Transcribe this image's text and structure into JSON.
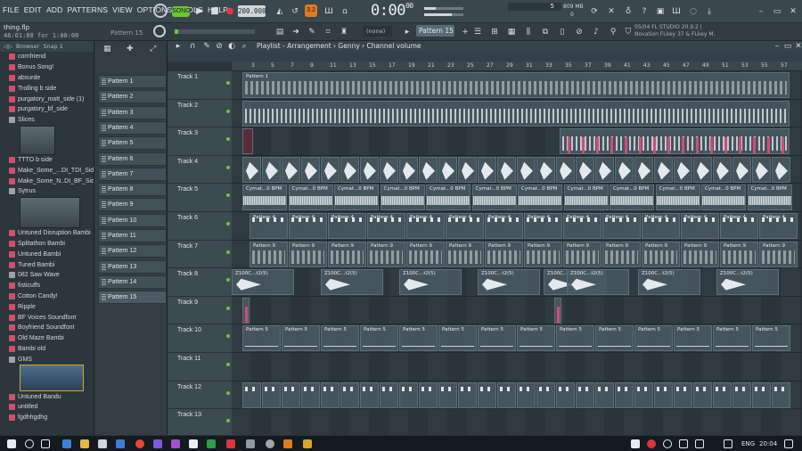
{
  "menu": [
    "FILE",
    "EDIT",
    "ADD",
    "PATTERNS",
    "VIEW",
    "OPTIONS",
    "TOOLS",
    "HELP"
  ],
  "toolbar": {
    "song_mode": "SONG",
    "bpm": "200.000",
    "time": "0:00",
    "time_sub": "00",
    "counter": "5",
    "memory": "809 MB",
    "memory_sub": "0",
    "step_label": "3.2"
  },
  "hint": {
    "title": "thing.flp",
    "time": "46:01:00 for 1:00:00",
    "pattern_label": "Pattern 15"
  },
  "pattern_select": "Pattern 15",
  "none_select": "(none)",
  "news": {
    "line1": "05/04  FL STUDIO 20.9.2 |",
    "line2": "Novation FLkey 37 & FLkey M."
  },
  "browser": {
    "header": [
      "Browser",
      "Snap 1"
    ],
    "items": [
      {
        "label": "cornfriend",
        "icon_color": "#d34d6f"
      },
      {
        "label": "Bonus Song!",
        "icon_color": "#d34d6f"
      },
      {
        "label": "absurde",
        "icon_color": "#d34d6f"
      },
      {
        "label": "Trolling b side",
        "icon_color": "#d34d6f"
      },
      {
        "label": "purgatory_matt_side (1)",
        "icon_color": "#d34d6f"
      },
      {
        "label": "purgatory_bf_side",
        "icon_color": "#d34d6f"
      },
      {
        "label": "Slices",
        "icon_color": "#9aa5ab"
      },
      {
        "label": "TTTO b side",
        "icon_color": "#d34d6f"
      },
      {
        "label": "Make_Some_...DI_TDI_Side",
        "icon_color": "#d34d6f"
      },
      {
        "label": "Make_Some_N..DI_BF_Side",
        "icon_color": "#d34d6f"
      },
      {
        "label": "Sytrus",
        "icon_color": "#9aa5ab"
      },
      {
        "label": "Untuned Disruption Bambi",
        "icon_color": "#d34d6f"
      },
      {
        "label": "Splitathon Bambi",
        "icon_color": "#d34d6f"
      },
      {
        "label": "Untuned Bambi",
        "icon_color": "#d34d6f"
      },
      {
        "label": "Tuned Bambi",
        "icon_color": "#d34d6f"
      },
      {
        "label": "082 Saw Wave",
        "icon_color": "#9aa5ab"
      },
      {
        "label": "fisticuffs",
        "icon_color": "#d34d6f"
      },
      {
        "label": "Cotton Candy!",
        "icon_color": "#d34d6f"
      },
      {
        "label": "Ripple",
        "icon_color": "#d34d6f"
      },
      {
        "label": "BF Voices Soundfont",
        "icon_color": "#d34d6f"
      },
      {
        "label": "Boyfriend Soundfont",
        "icon_color": "#d34d6f"
      },
      {
        "label": "Old Maze Bambi",
        "icon_color": "#d34d6f"
      },
      {
        "label": "Bambi old",
        "icon_color": "#d34d6f"
      },
      {
        "label": "GMS",
        "icon_color": "#9aa5ab"
      },
      {
        "label": "Untuned Bandu",
        "icon_color": "#d34d6f"
      },
      {
        "label": "untitled",
        "icon_color": "#d34d6f"
      },
      {
        "label": "fgdhhgdhg",
        "icon_color": "#d34d6f"
      }
    ]
  },
  "patterns": [
    "Pattern 1",
    "Pattern 2",
    "Pattern 3",
    "Pattern 4",
    "Pattern 5",
    "Pattern 6",
    "Pattern 7",
    "Pattern 8",
    "Pattern 9",
    "Pattern 10",
    "Pattern 11",
    "Pattern 12",
    "Pattern 13",
    "Pattern 14",
    "Pattern 15"
  ],
  "playlist": {
    "title": "Playlist - Arrangement › Genny › Channel volume",
    "ruler": [
      "3",
      "5",
      "7",
      "9",
      "11",
      "13",
      "15",
      "17",
      "19",
      "21",
      "23",
      "25",
      "27",
      "29",
      "31",
      "33",
      "35",
      "37",
      "39",
      "41",
      "43",
      "45",
      "47",
      "49",
      "51",
      "53",
      "55",
      "57"
    ],
    "tracks": [
      "Track 1",
      "Track 2",
      "Track 3",
      "Track 4",
      "Track 5",
      "Track 6",
      "Track 7",
      "Track 8",
      "Track 9",
      "Track 10",
      "Track 11",
      "Track 12",
      "Track 13"
    ],
    "clip_labels": {
      "track1": "Pattern 1",
      "track5": "Cymat...0 BPM",
      "track6": "Pattern 4",
      "track7": "Pattern 9",
      "track8": "Z100C...t2(5)",
      "track10": "Pattern 5"
    }
  },
  "taskbar": {
    "lang": "ENG",
    "time": "20:04"
  },
  "colors": {
    "accent_green": "#6fc43a",
    "pink": "#d34d6f",
    "orange": "#e07b22"
  }
}
